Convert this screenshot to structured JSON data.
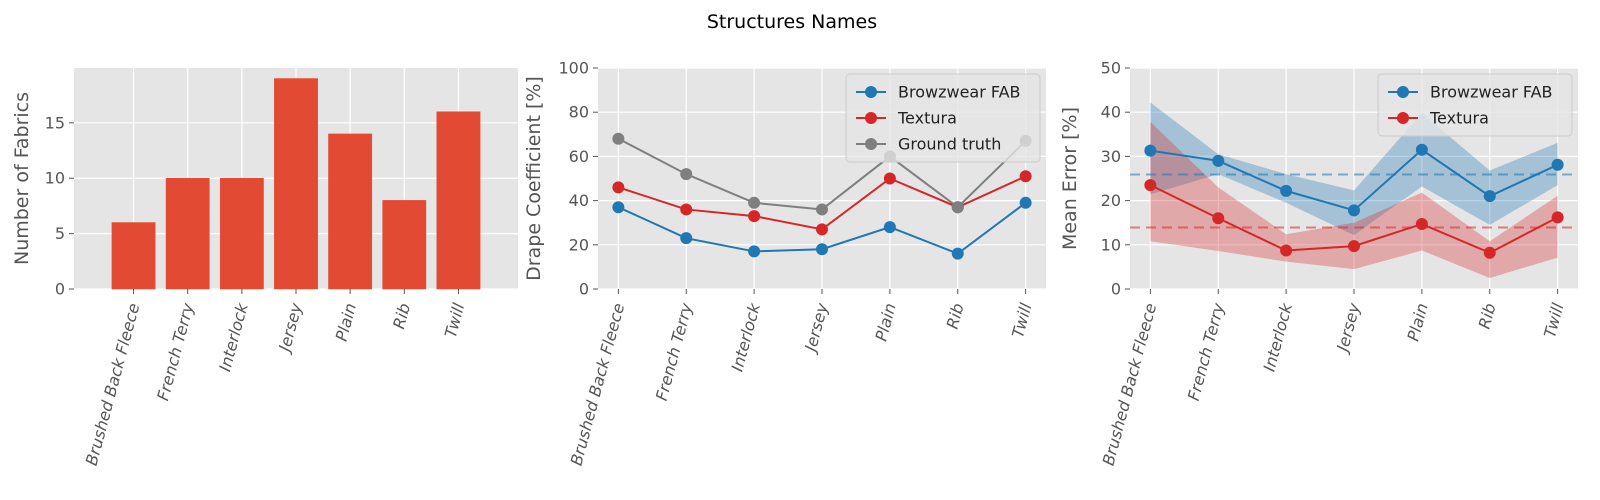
{
  "figure": {
    "title": "Structures Names"
  },
  "chart_data": [
    {
      "type": "bar",
      "title": "",
      "xlabel": "",
      "ylabel": "Number of Fabrics",
      "categories": [
        "Brushed Back Fleece",
        "French Terry",
        "Interlock",
        "Jersey",
        "Plain",
        "Rib",
        "Twill"
      ],
      "values": [
        6,
        10,
        10,
        19,
        14,
        8,
        16
      ],
      "ylim": [
        0,
        19.95
      ],
      "yticks": [
        0,
        5,
        10,
        15
      ],
      "grid": true,
      "color": "#E24A33"
    },
    {
      "type": "line",
      "title": "",
      "xlabel": "",
      "ylabel": "Drape Coefficient [%]",
      "categories": [
        "Brushed Back Fleece",
        "French Terry",
        "Interlock",
        "Jersey",
        "Plain",
        "Rib",
        "Twill"
      ],
      "ylim": [
        0,
        100
      ],
      "yticks": [
        0,
        20,
        40,
        60,
        80,
        100
      ],
      "grid": true,
      "legend_position": "top-right",
      "series": [
        {
          "name": "Browzwear FAB",
          "color": "#1f77b4",
          "values": [
            37,
            23,
            17,
            18,
            28,
            16,
            39
          ]
        },
        {
          "name": "Textura",
          "color": "#d62728",
          "values": [
            46,
            36,
            33,
            27,
            50,
            37,
            51
          ]
        },
        {
          "name": "Ground truth",
          "color": "#7f7f7f",
          "values": [
            68,
            52,
            39,
            36,
            60,
            37,
            67
          ]
        }
      ]
    },
    {
      "type": "line",
      "title": "",
      "xlabel": "",
      "ylabel": "Mean Error [%]",
      "categories": [
        "Brushed Back Fleece",
        "French Terry",
        "Interlock",
        "Jersey",
        "Plain",
        "Rib",
        "Twill"
      ],
      "ylim": [
        0,
        50
      ],
      "yticks": [
        0,
        10,
        20,
        30,
        40,
        50
      ],
      "grid": true,
      "legend_position": "top-right",
      "series": [
        {
          "name": "Browzwear FAB",
          "color": "#1f77b4",
          "values": [
            31.3,
            29.0,
            22.2,
            17.8,
            31.5,
            21.0,
            28.1
          ],
          "band_upper": [
            42.2,
            30.5,
            26.0,
            22.3,
            39.8,
            26.8,
            33.1
          ],
          "band_lower": [
            21.4,
            26.0,
            19.5,
            12.2,
            23.2,
            14.5,
            23.5
          ],
          "mean_line": 25.9
        },
        {
          "name": "Textura",
          "color": "#d62728",
          "values": [
            23.5,
            16.0,
            8.7,
            9.7,
            14.7,
            8.2,
            16.2
          ],
          "band_upper": [
            37.8,
            23.0,
            12.4,
            15.0,
            21.8,
            10.8,
            21.1
          ],
          "band_lower": [
            10.8,
            8.6,
            6.2,
            4.5,
            8.7,
            2.5,
            7.1
          ],
          "mean_line": 13.9
        }
      ]
    }
  ]
}
